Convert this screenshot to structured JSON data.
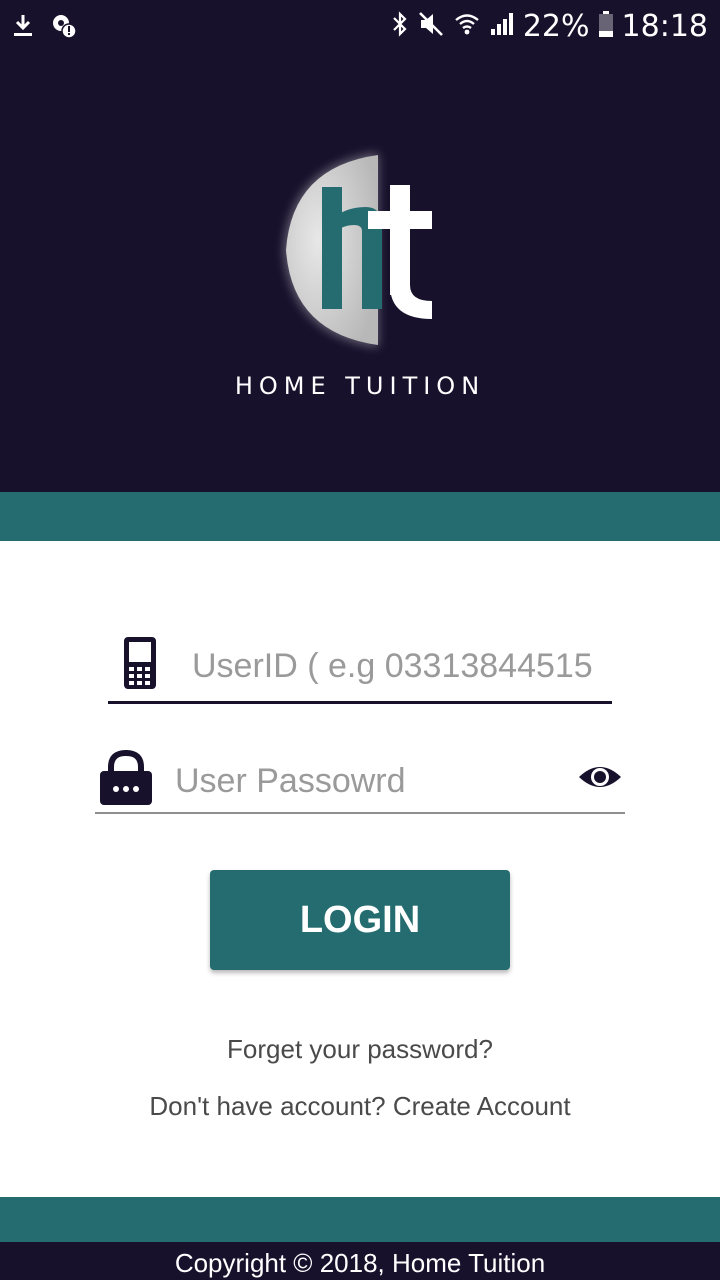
{
  "status_bar": {
    "battery": "22%",
    "time": "18:18",
    "icons_left": [
      "download-icon",
      "location-alert-icon"
    ],
    "icons_right": [
      "bluetooth-icon",
      "mute-icon",
      "wifi-icon",
      "signal-icon",
      "battery-icon"
    ]
  },
  "brand": {
    "logo_letters": "ht",
    "name": "HOME TUITION"
  },
  "login_form": {
    "userid_placeholder": "UserID ( e.g 03313844515",
    "userid_icon": "mobile-phone-icon",
    "password_placeholder": "User Passowrd",
    "password_icon": "lock-icon",
    "show_password_icon": "eye-icon",
    "login_label": "LOGIN",
    "forgot_label": "Forget your password?",
    "no_account_label": "Don't have account?",
    "create_account_label": "Create Account"
  },
  "footer": {
    "copyright": "Copyright © 2018, Home Tuition"
  },
  "colors": {
    "header_bg": "#18112c",
    "accent_teal": "#246c70",
    "button_text": "#ffffff"
  }
}
